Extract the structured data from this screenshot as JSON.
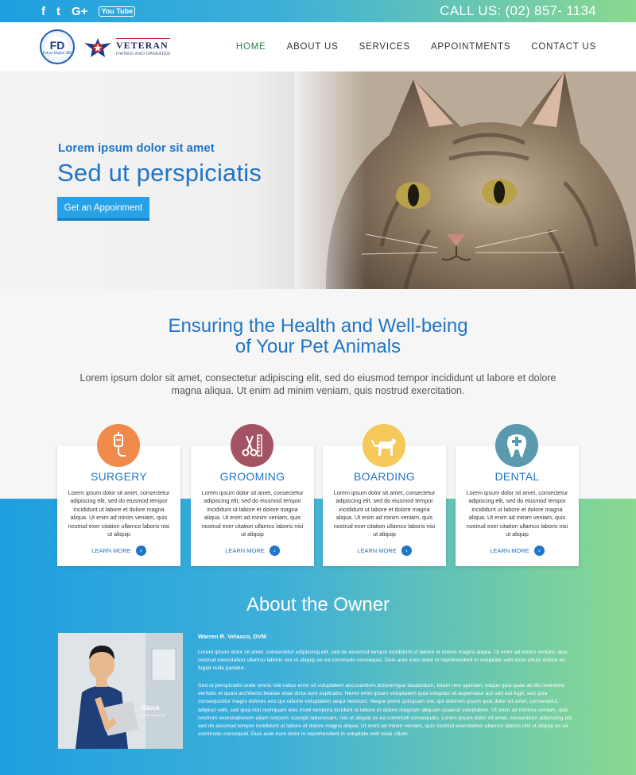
{
  "topbar": {
    "socials": [
      "f",
      "t",
      "G+",
      "You Tube"
    ],
    "call": "CALL US: (02) 857- 1134"
  },
  "header": {
    "logo_fd": "FD",
    "logo_fd_sub": "Future Digital 360",
    "veteran_title": "VETERAN",
    "veteran_sub": "OWNED AND OPERATED",
    "nav": [
      "HOME",
      "ABOUT US",
      "SERVICES",
      "APPOINTMENTS",
      "CONTACT US"
    ],
    "active_nav": "HOME"
  },
  "hero": {
    "subtitle": "Lorem ipsum dolor sit amet",
    "title": "Sed ut perspiciatis",
    "button": "Get an Appoinment"
  },
  "intro": {
    "title_line1": "Ensuring the Health and Well-being",
    "title_line2": "of Your Pet Animals",
    "text": "Lorem ipsum dolor sit amet, consectetur adipiscing elit, sed do eiusmod tempor incididunt ut labore et dolore magna aliqua. Ut enim ad minim veniam, quis nostrud exercitation."
  },
  "services": [
    {
      "title": "SURGERY",
      "icon": "iv-drip-icon",
      "color": "#f08a4b",
      "text": "Lorem ipsum dolor sit amet, consectetur adipiscing elit, sed do eiusmod tempor incididunt ut labore et dolore magna aliqua. Ut enim ad minim veniam, quis nostrud exer citation ullamco laboris nisi ut aliquip",
      "more": "LEARN MORE"
    },
    {
      "title": "GROOMING",
      "icon": "scissors-comb-icon",
      "color": "#a25462",
      "text": "Lorem ipsum dolor sit amet, consectetur adipiscing elit, sed do eiusmod tempor incididunt ut labore et dolore magna aliqua. Ut enim ad minim veniam, quis nostrud exer citation ullamco laboris nisi ut aliquip",
      "more": "LEARN MORE"
    },
    {
      "title": "BOARDING",
      "icon": "dog-icon",
      "color": "#f5c95a",
      "text": "Lorem ipsum dolor sit amet, consectetur adipiscing elit, sed do eiusmod tempor incididunt ut labore et dolore magna aliqua. Ut enim ad minim veniam, quis nostrud exer citation ullamco laboris nisi ut aliquip",
      "more": "LEARN MORE"
    },
    {
      "title": "DENTAL",
      "icon": "tooth-icon",
      "color": "#5b9aad",
      "text": "Lorem ipsum dolor sit amet, consectetur adipiscing elit, sed do eiusmod tempor incididunt ut labore et dolore magna aliqua. Ut enim ad minim veniam, quis nostrud exer citation ullamco laboris nisi ut aliquip",
      "more": "LEARN MORE"
    }
  ],
  "about": {
    "title": "About the Owner",
    "name": "Warren R. Velasco, DVM",
    "photo_watermark": "iStock",
    "photo_credit": "Credit: Edwin Tan",
    "p1": "Lorem ipsum dolor sit amet, consectetur adipiscing elit, sed do eiusmod tempor incididunt ut labore et dolore magna aliqua. Ut enim ad minim veniam, quis nostrud exercitation ullamco laboris nisi ut aliquip ex ea commodo consequat. Duis aute irure dolor in reprehenderit in voluptate velit esse cillum dolore eu fugiat nulla pariatur.",
    "p2": "Sed ut perspiciatis unde omnis iste natus error sit voluptatem accusantium doloremque laudantium, totam rem aperiam, eaque ipsa quae ab illo inventore veritatis et quasi architecto beatae vitae dicta sunt explicabo. Nemo enim ipsam voluptatem quia voluptas sit aspernatur aut odit aut fugit, sed quia consequuntur magni dolores eos qui ratione voluptatem sequi nesciunt. Neque porro quisquam est, qui dolorem ipsum quia dolor sit amet, consectetur, adipisci velit, sed quia non numquam eius modi tempora incidunt ut labore et dolore magnam aliquam quaerat voluptatem. Ut enim ad minima veniam, quis nostrum exercitationem ullam corporis suscipit laboriosam, nisi ut aliquid ex ea commodi consequatu. Lorem ipsum dolor sit amet, consectetur adipiscing elit, sed do eiusmod tempor incididunt ut labore et dolore magna aliqua. Ut enim ad minim veniam, quis nostrud exercitation ullamco laboris nisi ut aliquip ex ea commodo consequat. Duis aute irure dolor in reprehenderit in voluptate velit esse cillum."
  }
}
